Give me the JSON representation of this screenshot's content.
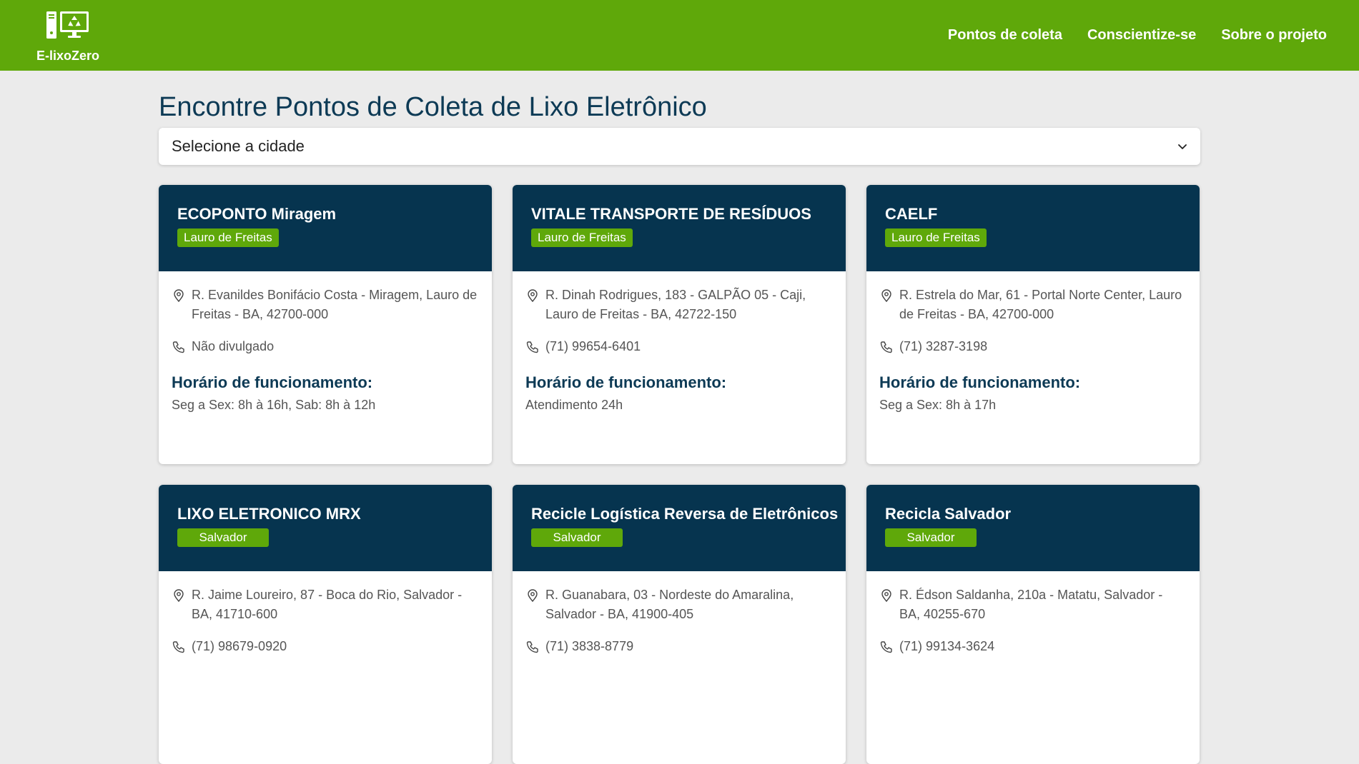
{
  "brand": {
    "name": "E-lixoZero",
    "logo_icon": "computer-recycle-icon"
  },
  "nav": [
    {
      "label": "Pontos de coleta"
    },
    {
      "label": "Conscientize-se"
    },
    {
      "label": "Sobre o projeto"
    }
  ],
  "page": {
    "title": "Encontre Pontos de Coleta de Lixo Eletrônico",
    "city_select": {
      "value": "Selecione a cidade",
      "icon": "chevron-down-icon"
    }
  },
  "labels": {
    "hours_title": "Horário de funcionamento:"
  },
  "colors": {
    "header_green": "#5fa80a",
    "card_navy": "#06344f",
    "title_blue": "#0d3a55",
    "background": "#ebebeb"
  },
  "cards": [
    {
      "name": "ECOPONTO Miragem",
      "city": "Lauro de Freitas",
      "address": "R. Evanildes Bonifácio Costa - Miragem, Lauro de Freitas - BA, 42700-000",
      "phone": "Não divulgado",
      "hours": "Seg a Sex: 8h à 16h, Sab: 8h à 12h"
    },
    {
      "name": "VITALE TRANSPORTE DE RESÍDUOS",
      "city": "Lauro de Freitas",
      "address": "R. Dinah Rodrigues, 183 - GALPÃO 05 - Caji, Lauro de Freitas - BA, 42722-150",
      "phone": "(71) 99654-6401",
      "hours": "Atendimento 24h"
    },
    {
      "name": "CAELF",
      "city": "Lauro de Freitas",
      "address": "R. Estrela do Mar, 61 - Portal Norte Center, Lauro de Freitas - BA, 42700-000",
      "phone": "(71) 3287-3198",
      "hours": "Seg a Sex: 8h à 17h"
    },
    {
      "name": "LIXO ELETRONICO MRX",
      "city": "Salvador",
      "address": "R. Jaime Loureiro, 87 - Boca do Rio, Salvador - BA, 41710-600",
      "phone": "(71) 98679-0920",
      "hours": ""
    },
    {
      "name": "Recicle Logística Reversa de Eletrônicos",
      "city": "Salvador",
      "address": "R. Guanabara, 03 - Nordeste do Amaralina, Salvador - BA, 41900-405",
      "phone": "(71) 3838-8779",
      "hours": ""
    },
    {
      "name": "Recicla Salvador",
      "city": "Salvador",
      "address": "R. Édson Saldanha, 210a - Matatu, Salvador - BA, 40255-670",
      "phone": "(71) 99134-3624",
      "hours": ""
    }
  ]
}
